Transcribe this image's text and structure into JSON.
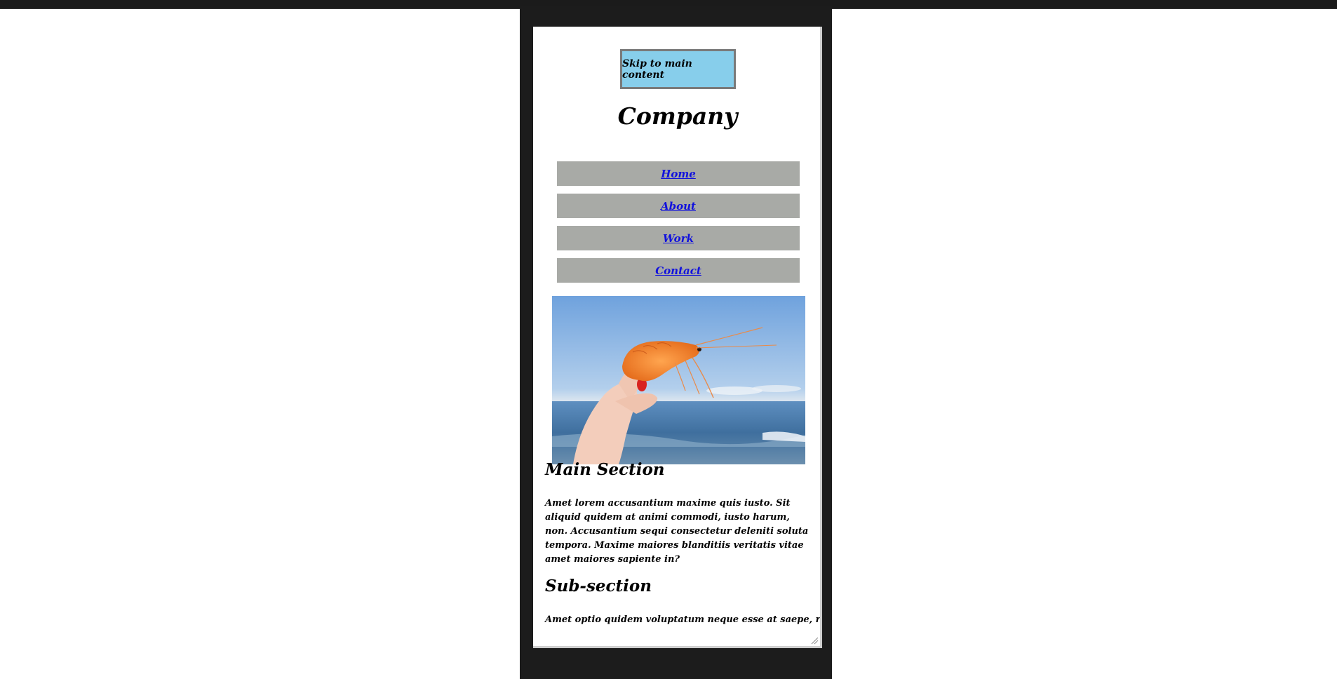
{
  "skip_link": {
    "label": "Skip to main content"
  },
  "header": {
    "title": "Company"
  },
  "nav": {
    "items": [
      {
        "label": "Home"
      },
      {
        "label": "About"
      },
      {
        "label": "Work"
      },
      {
        "label": "Contact"
      }
    ]
  },
  "hero": {
    "icon": "shrimp-photo"
  },
  "main": {
    "heading": "Main Section",
    "paragraph": "Amet lorem accusantium maxime quis iusto. Sit aliquid quidem at animi commodi, iusto harum, non. Accusantium sequi consectetur deleniti soluta tempora. Maxime maiores blanditiis veritatis vitae amet maiores sapiente in?",
    "sub_heading": "Sub-section",
    "sub_paragraph": "Amet optio quidem voluptatum neque esse at saepe, reiciendis"
  },
  "colors": {
    "skip_bg": "#87ceeb",
    "nav_bg": "#a8aaa6",
    "link": "#1111dd",
    "frame": "#1c1c1c"
  }
}
